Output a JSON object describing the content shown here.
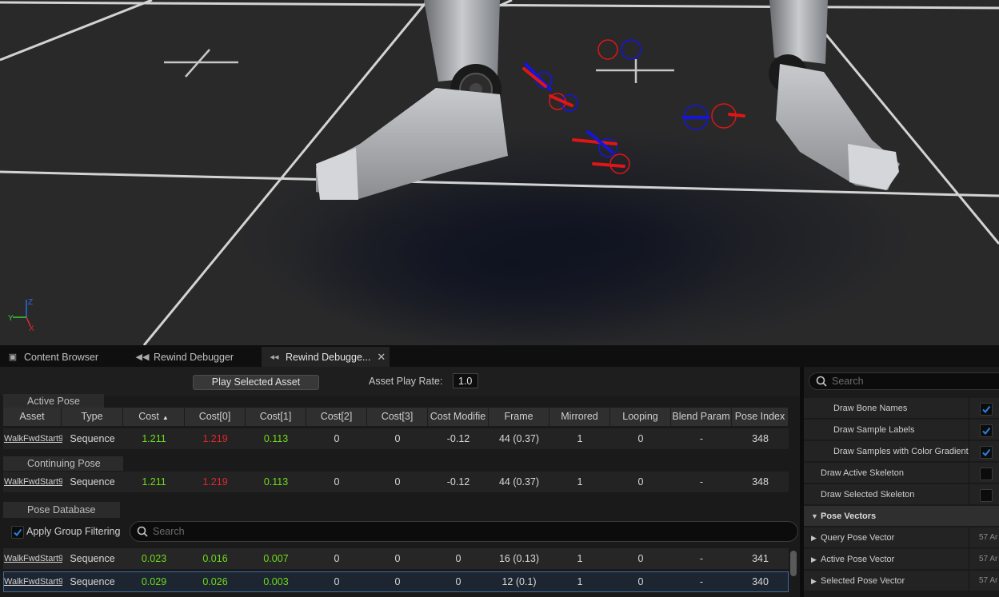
{
  "tabs": [
    {
      "label": "Content Browser",
      "icon": "content-browser-icon"
    },
    {
      "label": "Rewind Debugger",
      "icon": "rewind-icon"
    },
    {
      "label": "Rewind Debugge...",
      "icon": "rewind-details-icon",
      "close": "✕"
    }
  ],
  "toolbar": {
    "play_label": "Play Selected Asset",
    "rate_label": "Asset Play Rate:",
    "rate_value": "1.0"
  },
  "sections": {
    "active": "Active Pose",
    "continuing": "Continuing Pose",
    "database": "Pose Database"
  },
  "columns": [
    "Asset",
    "Type",
    "Cost",
    "Cost[0]",
    "Cost[1]",
    "Cost[2]",
    "Cost[3]",
    "Cost Modifie",
    "Frame",
    "Mirrored",
    "Looping",
    "Blend Param",
    "Pose Index"
  ],
  "active_row": [
    "WalkFwdStart9",
    "Sequence",
    "1.211",
    "1.219",
    "0.113",
    "0",
    "0",
    "-0.12",
    "44 (0.37)",
    "1",
    "0",
    "-",
    "348"
  ],
  "continuing_row": [
    "WalkFwdStart9",
    "Sequence",
    "1.211",
    "1.219",
    "0.113",
    "0",
    "0",
    "-0.12",
    "44 (0.37)",
    "1",
    "0",
    "-",
    "348"
  ],
  "filter": {
    "label": "Apply Group Filtering",
    "checked": true,
    "search_placeholder": "Search"
  },
  "database_rows": [
    [
      "WalkFwdStart9",
      "Sequence",
      "0.023",
      "0.016",
      "0.007",
      "0",
      "0",
      "0",
      "16 (0.13)",
      "1",
      "0",
      "-",
      "341"
    ],
    [
      "WalkFwdStart9",
      "Sequence",
      "0.029",
      "0.026",
      "0.003",
      "0",
      "0",
      "0",
      "12 (0.1)",
      "1",
      "0",
      "-",
      "340"
    ]
  ],
  "details": {
    "search_placeholder": "Search",
    "rows": [
      {
        "label": "Draw Bone Names",
        "checked": true
      },
      {
        "label": "Draw Sample Labels",
        "checked": true
      },
      {
        "label": "Draw Samples with Color Gradient",
        "checked": true
      },
      {
        "label": "Draw Active Skeleton",
        "checked": false
      },
      {
        "label": "Draw Selected Skeleton",
        "checked": false
      },
      {
        "label": "Pose Vectors",
        "category": true
      },
      {
        "label": "Query Pose Vector",
        "value": "57 Ar"
      },
      {
        "label": "Active Pose Vector",
        "value": "57 Ar"
      },
      {
        "label": "Selected Pose Vector",
        "value": "57 Ar"
      }
    ]
  },
  "viewport": {
    "axis_labels": {
      "z": "Z",
      "y": "Y",
      "x": "X"
    }
  },
  "colors": {
    "accent_blue": "#1f6fd1",
    "cost_good": "#6fdc1b",
    "cost_bad": "#e2262d"
  }
}
